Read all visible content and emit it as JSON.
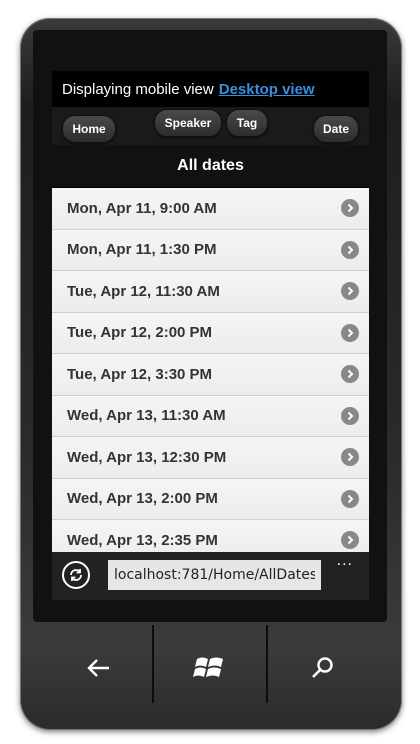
{
  "notice": {
    "text": "Displaying mobile view",
    "link": "Desktop view"
  },
  "nav": {
    "home": "Home",
    "speaker": "Speaker",
    "tag": "Tag",
    "date": "Date"
  },
  "header": {
    "title": "All dates"
  },
  "list": {
    "items": [
      "Mon, Apr 11, 9:00 AM",
      "Mon, Apr 11, 1:30 PM",
      "Tue, Apr 12, 11:30 AM",
      "Tue, Apr 12, 2:00 PM",
      "Tue, Apr 12, 3:30 PM",
      "Wed, Apr 13, 11:30 AM",
      "Wed, Apr 13, 12:30 PM",
      "Wed, Apr 13, 2:00 PM",
      "Wed, Apr 13, 2:35 PM"
    ]
  },
  "addressbar": {
    "url": "localhost:781/Home/AllDates",
    "more": "..."
  },
  "colors": {
    "link": "#3a8fdc",
    "list_bg": "#f1f1f1",
    "header_bg": "#111111"
  }
}
